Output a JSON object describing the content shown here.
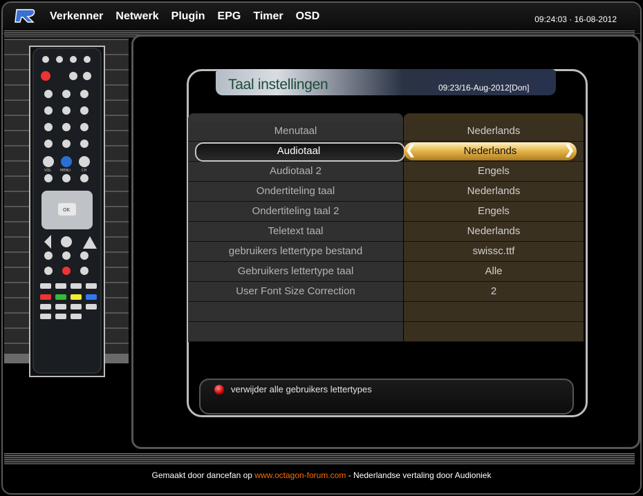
{
  "topbar": {
    "menu": [
      "Verkenner",
      "Netwerk",
      "Plugin",
      "EPG",
      "Timer",
      "OSD"
    ],
    "datetime": "09:24:03 · 16-08-2012"
  },
  "dialog": {
    "title": "Taal instellingen",
    "datetime": "09:23/16-Aug-2012[Don]",
    "rows": [
      {
        "label": "Menutaal",
        "value": "Nederlands"
      },
      {
        "label": "Audiotaal",
        "value": "Nederlands"
      },
      {
        "label": "Audiotaal 2",
        "value": "Engels"
      },
      {
        "label": "Ondertiteling taal",
        "value": "Nederlands"
      },
      {
        "label": "Ondertiteling taal 2",
        "value": "Engels"
      },
      {
        "label": "Teletext taal",
        "value": "Nederlands"
      },
      {
        "label": "gebruikers lettertype bestand",
        "value": "swissc.ttf"
      },
      {
        "label": "Gebruikers lettertype taal",
        "value": "Alle"
      },
      {
        "label": "User Font Size Correction",
        "value": "2"
      },
      {
        "label": "",
        "value": ""
      },
      {
        "label": "",
        "value": ""
      }
    ],
    "selected_index": 1,
    "legend": "verwijder alle gebruikers lettertypes"
  },
  "remote": {
    "labels": [
      "VOL",
      "MENU",
      "CH",
      "OK"
    ]
  },
  "footer": {
    "prefix": "Gemaakt door dancefan op",
    "link": "www.octagon-forum.com",
    "suffix": "- Nederlandse vertaling door Audioniek"
  },
  "colors": {
    "accent_gold": "#e8b94f",
    "value_column": "#3a3020",
    "label_column": "#303030",
    "link": "#ff6a00"
  }
}
